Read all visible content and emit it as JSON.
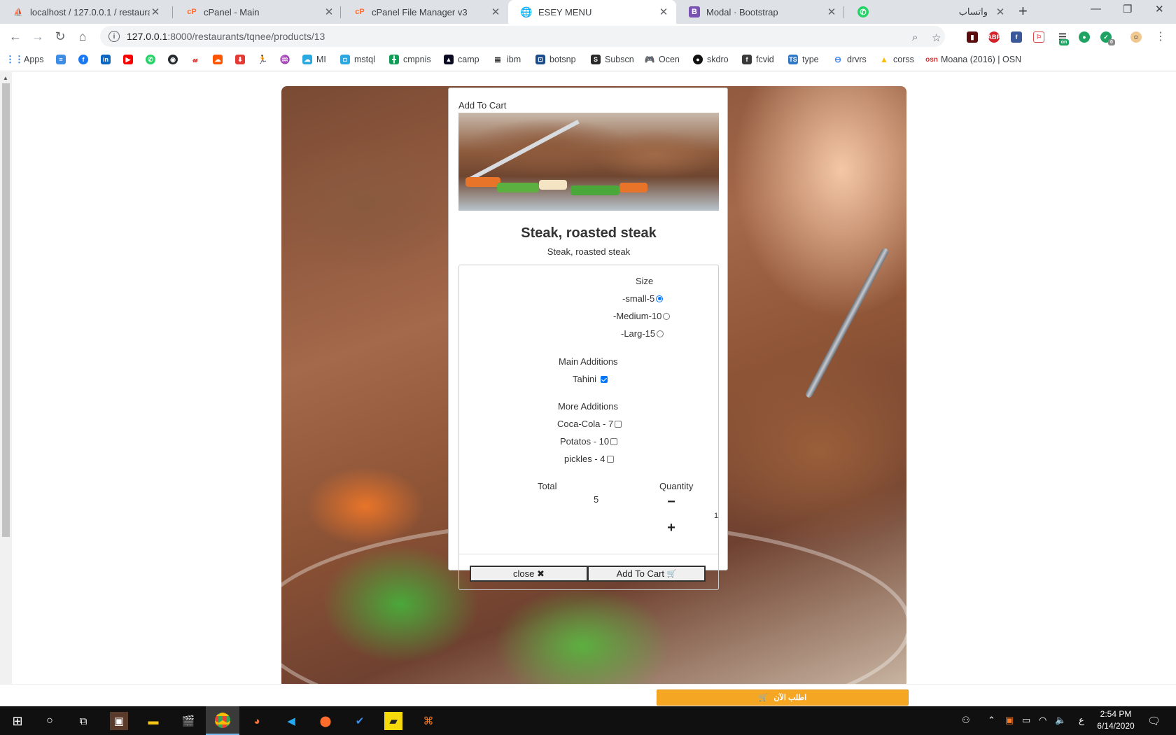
{
  "browser": {
    "tabs": [
      {
        "title": "localhost / 127.0.0.1 / restaurant",
        "favicon": "phpmyadmin-icon"
      },
      {
        "title": "cPanel - Main",
        "favicon": "cpanel-icon"
      },
      {
        "title": "cPanel File Manager v3",
        "favicon": "cpanel-icon"
      },
      {
        "title": "ESEY MENU",
        "favicon": "globe-icon",
        "active": true
      },
      {
        "title": "Modal · Bootstrap",
        "favicon": "bootstrap-icon"
      },
      {
        "title": "واتساب",
        "favicon": "whatsapp-icon"
      }
    ],
    "url_host": "127.0.0.1",
    "url_path": ":8000/restaurants/tqnee/products/13",
    "bookmarks": [
      "Apps",
      "MI",
      "mstql",
      "cmpnis",
      "camp",
      "ibm",
      "botsnp",
      "Subscn",
      "Ocen",
      "skdro",
      "fcvid",
      "type",
      "drvrs",
      "corss",
      "Moana (2016) | OSN"
    ],
    "extension_badges": {
      "on": "on",
      "count": "0"
    }
  },
  "modal": {
    "title": "Add To Cart",
    "product_name": "Steak, roasted steak",
    "product_description": "Steak, roasted steak",
    "size_label": "Size",
    "sizes": [
      {
        "label": "-small-5",
        "checked": true
      },
      {
        "label": "-Medium-10",
        "checked": false
      },
      {
        "label": "-Larg-15",
        "checked": false
      }
    ],
    "main_additions_label": "Main Additions",
    "main_additions": [
      {
        "label": "Tahini",
        "checked": true
      }
    ],
    "more_additions_label": "More Additions",
    "more_additions": [
      {
        "label": "Coca-Cola - 7",
        "checked": false
      },
      {
        "label": "Potatos - 10",
        "checked": false
      },
      {
        "label": "pickles - 4",
        "checked": false
      }
    ],
    "total_label": "Total",
    "total_value": "5",
    "quantity_label": "Quantity",
    "quantity_value": "1",
    "minus_symbol": "−",
    "plus_symbol": "+",
    "close_label": "close",
    "close_icon": "✖",
    "add_to_cart_label": "Add To Cart",
    "cart_icon": "🛒"
  },
  "order_bar": {
    "order_now_label": "اطلب الآن"
  },
  "taskbar": {
    "time": "2:54 PM",
    "date": "6/14/2020",
    "input_language": "ع"
  },
  "colors": {
    "accent": "#0075ff",
    "order_button": "#f5a623",
    "taskbar": "#101010",
    "tabstrip": "#dee1e6"
  }
}
